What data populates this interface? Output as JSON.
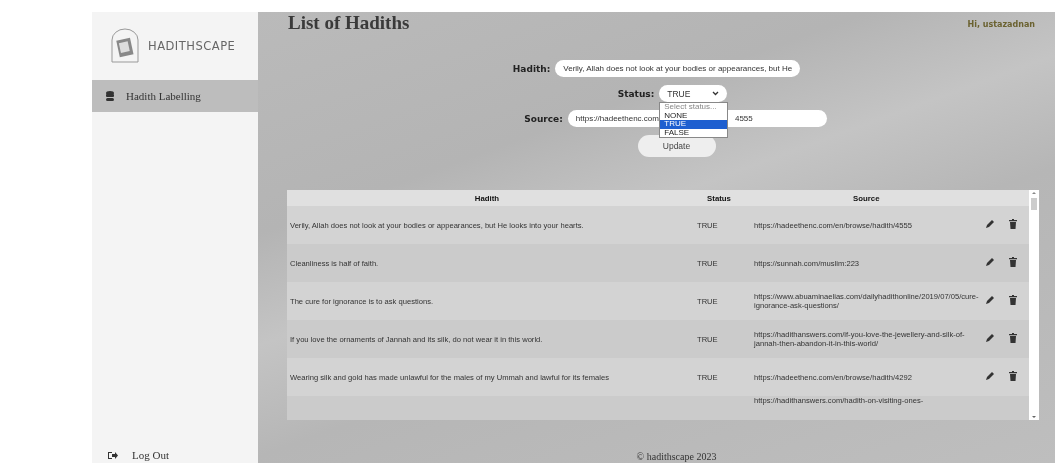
{
  "sidebar": {
    "logo": "HADITHSCAPE",
    "items": [
      {
        "label": "Hadith Labelling",
        "selected": true
      }
    ],
    "logout": "Log Out"
  },
  "header": {
    "title": "List of Hadiths",
    "greeting": "Hi, ustazadnan"
  },
  "form": {
    "hadith": {
      "label": "Hadith:",
      "value": "Verily, Allah does not look at your bodies or appearances, but He"
    },
    "status": {
      "label": "Status:",
      "value": "TRUE",
      "expanded": true,
      "options": [
        {
          "label": "Select status...",
          "selected": false,
          "kind": "hint"
        },
        {
          "label": "NONE",
          "selected": false,
          "kind": "option"
        },
        {
          "label": "TRUE",
          "selected": true,
          "kind": "option"
        },
        {
          "label": "FALSE",
          "selected": false,
          "kind": "option"
        }
      ]
    },
    "source": {
      "label": "Source:",
      "value_parts": [
        "https://hadeethenc.com",
        "4555"
      ]
    },
    "button": "Update"
  },
  "table": {
    "columns": [
      "Hadith",
      "Status",
      "Source"
    ],
    "rows": [
      {
        "hadith": "Verily, Allah does not look at your bodies or appearances, but He looks into your hearts.",
        "status": "TRUE",
        "source": "https://hadeethenc.com/en/browse/hadith/4555"
      },
      {
        "hadith": "Cleanliness is half of faith.",
        "status": "TRUE",
        "source": "https://sunnah.com/muslim:223"
      },
      {
        "hadith": "The cure for ignorance is to ask questions.",
        "status": "TRUE",
        "source": "https://www.abuaminaelias.com/dailyhadithonline/2019/07/05/cure-ignorance-ask-questions/"
      },
      {
        "hadith": "If you love the ornaments of Jannah and its silk, do not wear it in this world.",
        "status": "TRUE",
        "source": "https://hadithanswers.com/if-you-love-the-jewellery-and-silk-of-jannah-then-abandon-it-in-this-world/"
      },
      {
        "hadith": "Wearing silk and gold has made unlawful for the males of my Ummah and lawful for its females",
        "status": "TRUE",
        "source": "https://hadeethenc.com/en/browse/hadith/4292"
      },
      {
        "source": "https://hadithanswers.com/hadith-on-visiting-ones-"
      }
    ]
  },
  "footer": "© hadithscape 2023"
}
